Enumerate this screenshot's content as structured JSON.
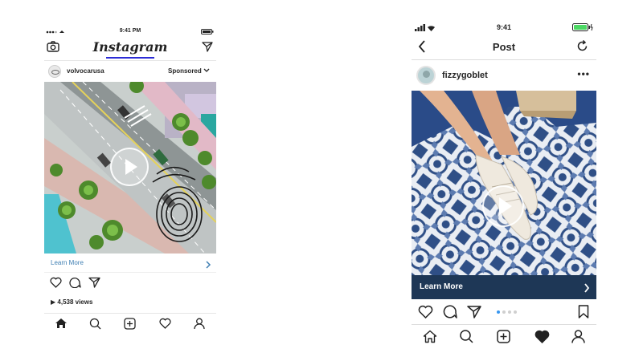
{
  "left_phone": {
    "status": {
      "time": "9:41 PM"
    },
    "header": {
      "logo": "Instagram"
    },
    "post": {
      "username": "volvocarusa",
      "sponsored_label": "Sponsored",
      "cta_label": "Learn More",
      "views_label": "4,538 views"
    },
    "icons": {
      "header": [
        "camera-icon",
        "direct-send-icon"
      ],
      "actions": [
        "heart-icon",
        "comment-icon",
        "share-icon"
      ],
      "tabbar": [
        "home-icon",
        "search-icon",
        "add-post-icon",
        "activity-heart-icon",
        "profile-icon"
      ]
    }
  },
  "right_phone": {
    "status": {
      "time": "9:41"
    },
    "header": {
      "title": "Post"
    },
    "post": {
      "username": "fizzygoblet",
      "cta_label": "Learn More",
      "carousel_pages": 4,
      "carousel_active": 1
    },
    "icons": {
      "header": [
        "back-chevron-icon",
        "refresh-icon"
      ],
      "actions": [
        "heart-icon",
        "comment-icon",
        "share-icon",
        "bookmark-icon"
      ],
      "tabbar": [
        "home-icon",
        "search-icon",
        "add-post-icon",
        "activity-heart-icon",
        "profile-icon"
      ]
    }
  },
  "colors": {
    "link_blue": "#3f7fb3",
    "cta_bar": "#1e3756",
    "accent_carousel_dot": "#3897f0",
    "logo_underline": "#2b2bd6"
  }
}
